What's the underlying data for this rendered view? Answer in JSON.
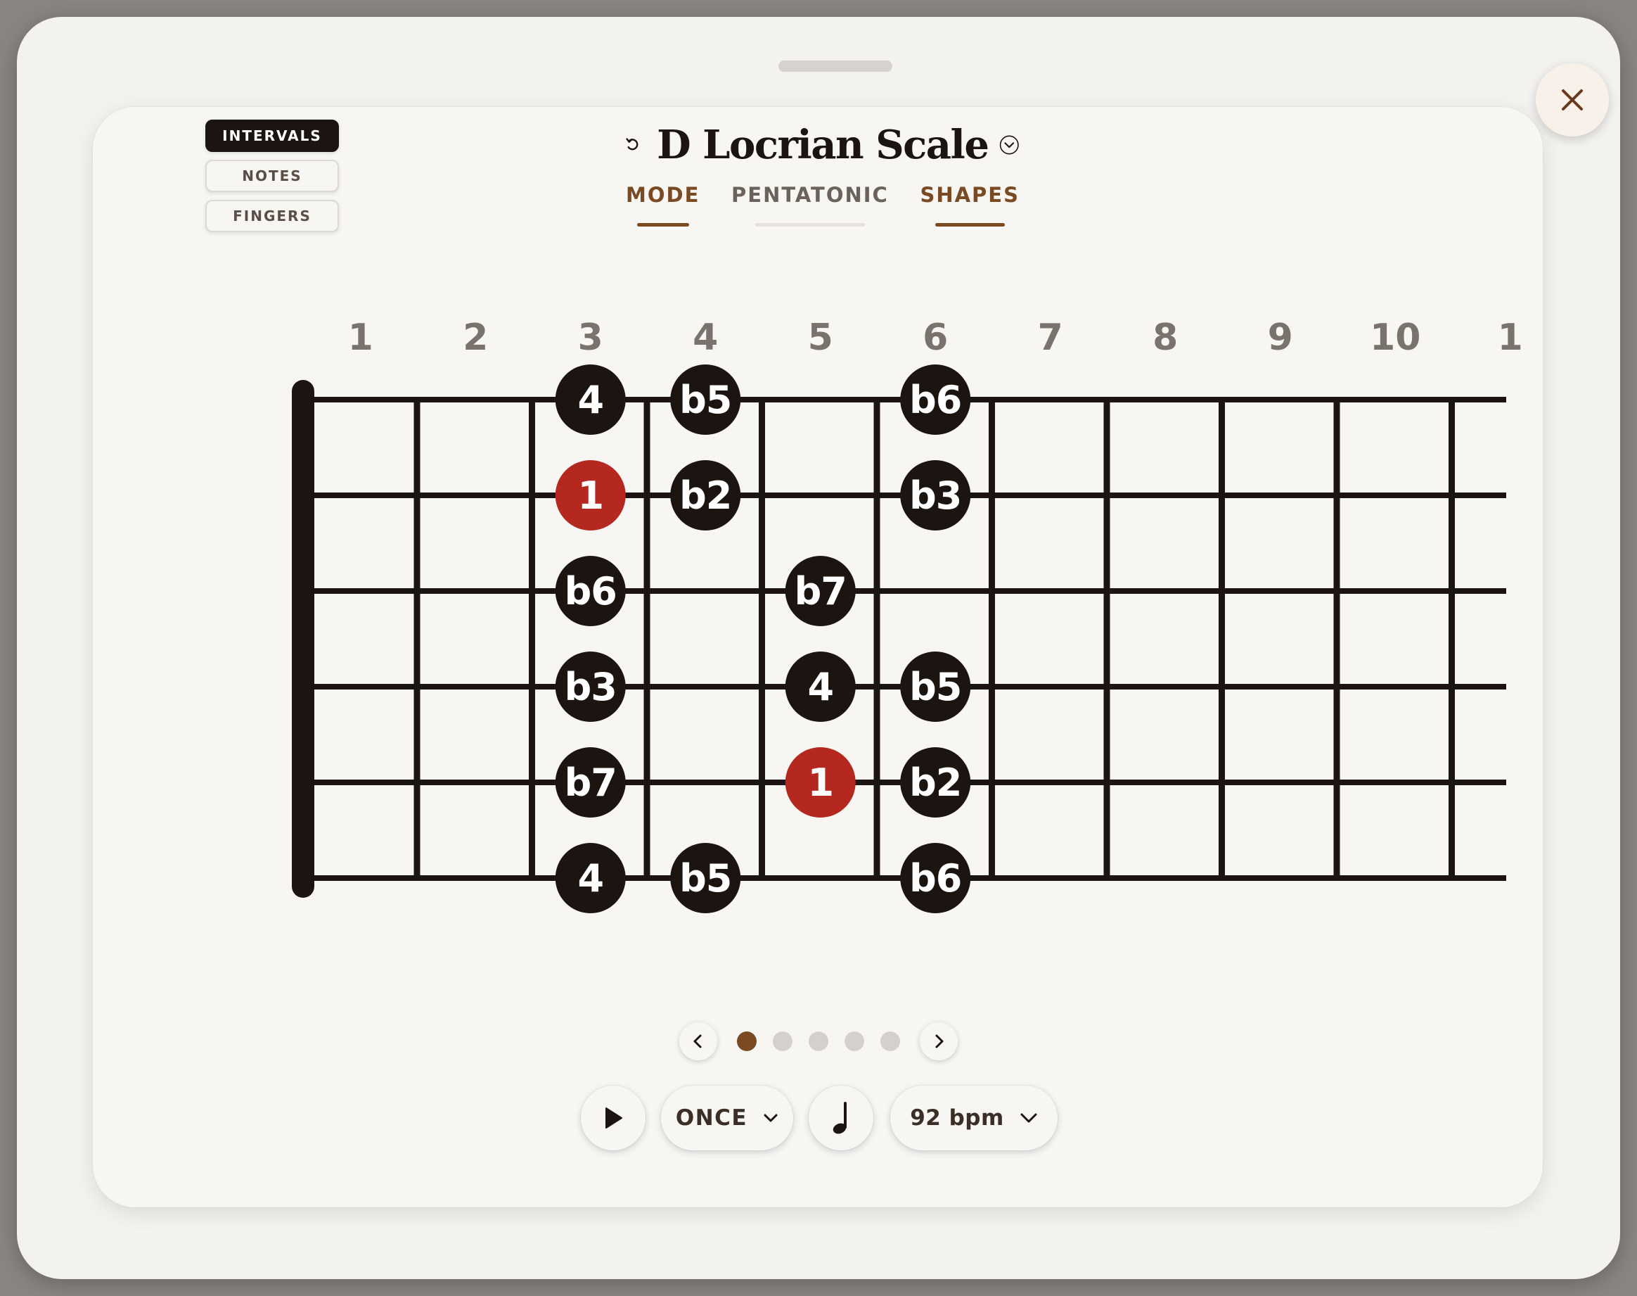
{
  "view_toggle": {
    "intervals": "INTERVALS",
    "notes": "NOTES",
    "fingers": "FINGERS",
    "active": "intervals"
  },
  "scale": {
    "title": "D Locrian Scale"
  },
  "tabs": [
    {
      "label": "MODE",
      "active": true
    },
    {
      "label": "PENTATONIC",
      "active": false
    },
    {
      "label": "SHAPES",
      "active": true
    }
  ],
  "fretboard": {
    "fret_numbers": [
      "1",
      "2",
      "3",
      "4",
      "5",
      "6",
      "7",
      "8",
      "9",
      "10",
      "1"
    ],
    "markers": [
      {
        "string": 1,
        "fret": 3,
        "label": "4",
        "root": false
      },
      {
        "string": 1,
        "fret": 4,
        "label": "b5",
        "root": false
      },
      {
        "string": 1,
        "fret": 6,
        "label": "b6",
        "root": false
      },
      {
        "string": 2,
        "fret": 3,
        "label": "1",
        "root": true
      },
      {
        "string": 2,
        "fret": 4,
        "label": "b2",
        "root": false
      },
      {
        "string": 2,
        "fret": 6,
        "label": "b3",
        "root": false
      },
      {
        "string": 3,
        "fret": 3,
        "label": "b6",
        "root": false
      },
      {
        "string": 3,
        "fret": 5,
        "label": "b7",
        "root": false
      },
      {
        "string": 4,
        "fret": 3,
        "label": "b3",
        "root": false
      },
      {
        "string": 4,
        "fret": 5,
        "label": "4",
        "root": false
      },
      {
        "string": 4,
        "fret": 6,
        "label": "b5",
        "root": false
      },
      {
        "string": 5,
        "fret": 3,
        "label": "b7",
        "root": false
      },
      {
        "string": 5,
        "fret": 5,
        "label": "1",
        "root": true
      },
      {
        "string": 5,
        "fret": 6,
        "label": "b2",
        "root": false
      },
      {
        "string": 6,
        "fret": 3,
        "label": "4",
        "root": false
      },
      {
        "string": 6,
        "fret": 4,
        "label": "b5",
        "root": false
      },
      {
        "string": 6,
        "fret": 6,
        "label": "b6",
        "root": false
      }
    ]
  },
  "pager": {
    "pages": 5,
    "current": 1
  },
  "controls": {
    "repeat_mode": "ONCE",
    "tempo": "92 bpm"
  },
  "colors": {
    "marker": "#1c1410",
    "root": "#b5281f",
    "accent": "#7a4a22"
  }
}
